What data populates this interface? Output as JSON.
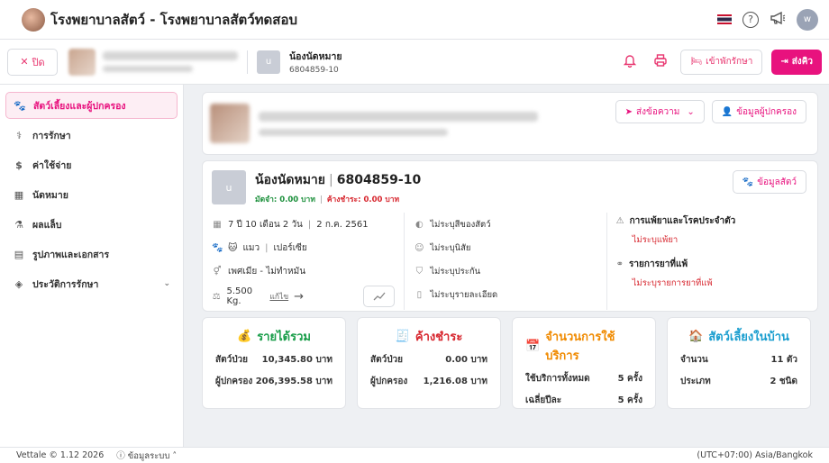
{
  "app": {
    "title": "โรงพยาบาลสัตว์ - โรงพยาบาลสัตว์ทดสอบ",
    "avatar_letter": "w"
  },
  "subbar": {
    "close_label": "ปิด",
    "pet_thumb_letter": "u",
    "pet_name": "น้องนัดหมาย",
    "pet_id": "6804859-10",
    "admit_label": "เข้าพักรักษา",
    "queue_label": "ส่งคิว"
  },
  "sidebar": {
    "items": [
      {
        "label": "สัตว์เลี้ยงและผู้ปกครอง",
        "icon": "paw-icon"
      },
      {
        "label": "การรักษา",
        "icon": "stethoscope-icon"
      },
      {
        "label": "ค่าใช้จ่าย",
        "icon": "receipt-icon"
      },
      {
        "label": "นัดหมาย",
        "icon": "calendar-icon"
      },
      {
        "label": "ผลแล็บ",
        "icon": "test-tube-icon"
      },
      {
        "label": "รูปภาพและเอกสาร",
        "icon": "document-icon"
      },
      {
        "label": "ประวัติการรักษา",
        "icon": "history-icon"
      }
    ]
  },
  "owner": {
    "send_message_label": "ส่งข้อความ",
    "owner_info_label": "ข้อมูลผู้ปกครอง"
  },
  "pet": {
    "thumb_letter": "u",
    "name": "น้องนัดหมาย",
    "id": "6804859-10",
    "deposit": "มัดจำ: 0.00 บาท",
    "outstanding": "ค้างชำระ: 0.00 บาท",
    "pet_info_label": "ข้อมูลสัตว์",
    "age": "7 ปี 10 เดือน 2 วัน",
    "birthdate": "2 ก.ค. 2561",
    "species": "แมว",
    "breed": "เปอร์เซีย",
    "sex": "เพศเมีย - ไม่ทำหมัน",
    "weight": "5.500 Kg.",
    "edit_label": "แก้ไข",
    "color": "ไม่ระบุสีของสัตว์",
    "temperament": "ไม่ระบุนิสัย",
    "insurance": "ไม่ระบุประกัน",
    "details": "ไม่ระบุรายละเอียด",
    "allergy_title": "การแพ้ยาและโรคประจำตัว",
    "allergy_value": "ไม่ระบุแพ้ยา",
    "drug_title": "รายการยาที่แพ้",
    "drug_value": "ไม่ระบุรายการยาที่แพ้"
  },
  "stats": {
    "revenue": {
      "title": "รายได้รวม",
      "color": "#1a9e4a",
      "rows": [
        {
          "k": "สัตว์ป่วย",
          "v": "10,345.80 บาท"
        },
        {
          "k": "ผู้ปกครอง",
          "v": "206,395.58 บาท"
        }
      ]
    },
    "outstanding": {
      "title": "ค้างชำระ",
      "color": "#d7262e",
      "rows": [
        {
          "k": "สัตว์ป่วย",
          "v": "0.00 บาท"
        },
        {
          "k": "ผู้ปกครอง",
          "v": "1,216.08 บาท"
        }
      ]
    },
    "visits": {
      "title": "จำนวนการใช้บริการ",
      "color": "#f08a00",
      "rows": [
        {
          "k": "ใช้บริการทั้งหมด",
          "v": "5 ครั้ง"
        },
        {
          "k": "เฉลี่ยปีละ",
          "v": "5 ครั้ง"
        }
      ]
    },
    "household": {
      "title": "สัตว์เลี้ยงในบ้าน",
      "color": "#1a9ecf",
      "rows": [
        {
          "k": "จำนวน",
          "v": "11 ตัว"
        },
        {
          "k": "ประเภท",
          "v": "2 ชนิด"
        }
      ]
    }
  },
  "footer": {
    "version": "Vettale © 1.12 2026",
    "sysinfo": "ข้อมูลระบบ",
    "timezone": "(UTC+07:00) Asia/Bangkok"
  }
}
